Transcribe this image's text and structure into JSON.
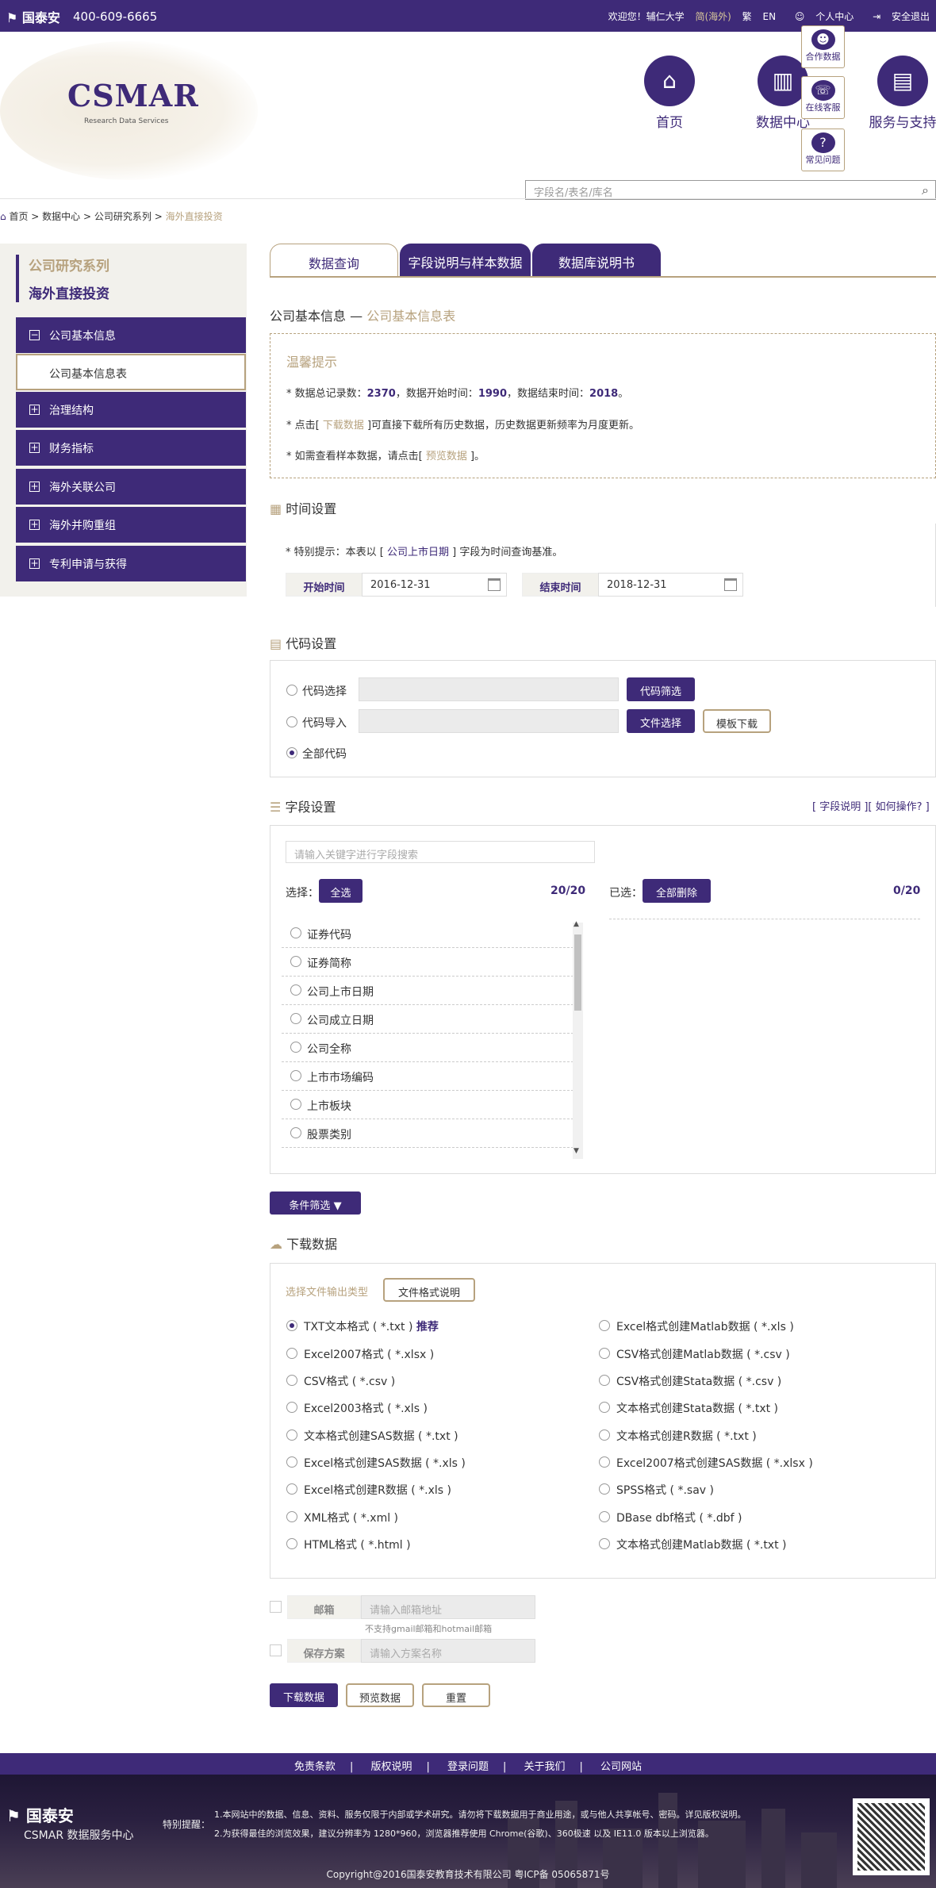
{
  "topbar": {
    "logo": "国泰安",
    "phone": "400-609-6665",
    "welcome": "欢迎您！辅仁大学",
    "region": "简(海外)",
    "trad": "繁",
    "en": "EN",
    "personal": "个人中心",
    "logout": "安全退出"
  },
  "header": {
    "brand": "CSMAR",
    "brand_sub": "Research Data Services",
    "nav": [
      {
        "label": "首页",
        "icon": "home-icon"
      },
      {
        "label": "数据中心",
        "icon": "monitor-icon"
      },
      {
        "label": "服务与支持",
        "icon": "book-icon"
      }
    ],
    "float": [
      {
        "label": "合作数据",
        "icon": "users-icon"
      },
      {
        "label": "在线客服",
        "icon": "headset-icon"
      },
      {
        "label": "常见问题",
        "icon": "question-icon"
      }
    ],
    "search_placeholder": "字段名/表名/库名"
  },
  "breadcrumb": [
    "首页",
    "数据中心",
    "公司研究系列",
    "海外直接投资"
  ],
  "sidebar": {
    "series": "公司研究系列",
    "db": "海外直接投资",
    "items": [
      {
        "label": "公司基本信息",
        "expanded": true
      },
      {
        "label": "公司基本信息表",
        "sub": true
      },
      {
        "label": "治理结构"
      },
      {
        "label": "财务指标"
      },
      {
        "label": "海外关联公司"
      },
      {
        "label": "海外并购重组"
      },
      {
        "label": "专利申请与获得"
      }
    ]
  },
  "tabs": [
    "数据查询",
    "字段说明与样本数据",
    "数据库说明书"
  ],
  "page_title": {
    "main": "公司基本信息 — ",
    "table": "公司基本信息表"
  },
  "tips": {
    "title": "温馨提示",
    "l1_a": "* 数据总记录数：",
    "l1_count": "2370",
    "l1_b": "，数据开始时间：",
    "l1_start": "1990",
    "l1_c": "，数据结束时间：",
    "l1_end": "2018",
    "l1_d": "。",
    "l2_a": "* 点击[",
    "l2_link": " 下载数据 ",
    "l2_b": "]可直接下载所有历史数据，历史数据更新频率为月度更新。",
    "l3_a": "* 如需查看样本数据，请点击[",
    "l3_link": " 预览数据 ",
    "l3_b": "]。"
  },
  "time": {
    "title": "时间设置",
    "note_a": "* 特别提示：本表以 [ ",
    "note_link": "公司上市日期",
    "note_b": " ] 字段为时间查询基准。",
    "start_label": "开始时间",
    "start_value": "2016-12-31",
    "end_label": "结束时间",
    "end_value": "2018-12-31"
  },
  "code": {
    "title": "代码设置",
    "opt1": "代码选择",
    "opt2": "代码导入",
    "opt3": "全部代码",
    "btn_filter": "代码筛选",
    "btn_file": "文件选择",
    "btn_template": "模板下载"
  },
  "fields": {
    "title": "字段设置",
    "help": "[ 字段说明 ][ 如何操作? ]",
    "search_placeholder": "请输入关键字进行字段搜索",
    "select_label": "选择：",
    "select_all": "全选",
    "count_left": "20/20",
    "chosen_label": "已选：",
    "delete_all": "全部删除",
    "count_right": "0/20",
    "items": [
      "证券代码",
      "证券简称",
      "公司上市日期",
      "公司成立日期",
      "公司全称",
      "上市市场编码",
      "上市板块",
      "股票类别"
    ]
  },
  "cond_filter": "条件筛选",
  "download": {
    "title": "下载数据",
    "type_label": "选择文件输出类型",
    "type_btn": "文件格式说明",
    "recommend": "推荐",
    "left": [
      "TXT文本格式 ( *.txt )",
      "Excel2007格式 ( *.xlsx )",
      "CSV格式 ( *.csv )",
      "Excel2003格式 ( *.xls )",
      "文本格式创建SAS数据 ( *.txt )",
      "Excel格式创建SAS数据 ( *.xls )",
      "Excel格式创建R数据 ( *.xls )",
      "XML格式 ( *.xml )",
      "HTML格式 ( *.html )"
    ],
    "right": [
      "Excel格式创建Matlab数据 ( *.xls )",
      "CSV格式创建Matlab数据 ( *.csv )",
      "CSV格式创建Stata数据 ( *.csv )",
      "文本格式创建Stata数据 ( *.txt )",
      "文本格式创建R数据 ( *.txt )",
      "Excel2007格式创建SAS数据 ( *.xlsx )",
      "SPSS格式 ( *.sav )",
      "DBase dbf格式 ( *.dbf )",
      "文本格式创建Matlab数据 ( *.txt )"
    ]
  },
  "email": {
    "label": "邮箱",
    "placeholder": "请输入邮箱地址",
    "note": "不支持gmail邮箱和hotmail邮箱",
    "scheme_label": "保存方案",
    "scheme_placeholder": "请输入方案名称"
  },
  "actions": {
    "download": "下载数据",
    "preview": "预览数据",
    "reset": "重置"
  },
  "footer": {
    "links": [
      "免责条款",
      "版权说明",
      "登录问题",
      "关于我们",
      "公司网站"
    ],
    "logo": "国泰安",
    "center": "CSMAR 数据服务中心",
    "notice_label": "特别提醒：",
    "notice1": "1.本网站中的数据、信息、资料、服务仅限于内部或学术研究。请勿将下载数据用于商业用途，或与他人共享帐号、密码。详见版权说明。",
    "notice2": "2.为获得最佳的浏览效果，建议分辨率为 1280*960，浏览器推荐使用 Chrome(谷歌)、360极速 以及 IE11.0 版本以上浏览器。",
    "copyright": "Copyright@2016国泰安教育技术有限公司 粤ICP备 05065871号"
  },
  "colors": {
    "brand": "#3e2a78",
    "accent": "#b7a27e"
  }
}
